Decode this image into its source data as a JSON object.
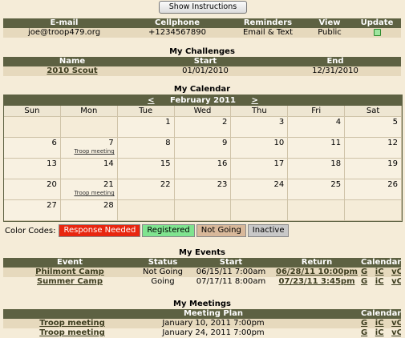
{
  "top_button": "Show Instructions",
  "contact": {
    "headers": [
      "E-mail",
      "Cellphone",
      "Reminders",
      "View",
      "Update"
    ],
    "email": "joe@troop479.org",
    "cellphone": "+1234567890",
    "reminders": "Email & Text",
    "view": "Public"
  },
  "challenges": {
    "title": "My Challenges",
    "headers": [
      "Name",
      "Start",
      "End"
    ],
    "rows": [
      [
        "2010 Scout",
        "01/01/2010",
        "12/31/2010"
      ]
    ]
  },
  "calendar": {
    "title": "My Calendar",
    "prev": "<",
    "next": ">",
    "month": "February 2011",
    "weekdays": [
      "Sun",
      "Mon",
      "Tue",
      "Wed",
      "Thu",
      "Fri",
      "Sat"
    ],
    "event_label": "Troop meeting"
  },
  "color_codes": {
    "label": "Color Codes:",
    "items": [
      {
        "text": "Response Needed",
        "color": "#e8260f",
        "fg": "#ffffff"
      },
      {
        "text": "Registered",
        "color": "#7fe38f",
        "fg": "#000000"
      },
      {
        "text": "Not Going",
        "color": "#d8b89a",
        "fg": "#000000"
      },
      {
        "text": "Inactive",
        "color": "#c8c8c8",
        "fg": "#000000"
      }
    ]
  },
  "events": {
    "title": "My Events",
    "headers": [
      "Event",
      "Status",
      "Start",
      "Return",
      "Calendar"
    ],
    "rows": [
      {
        "event": "Philmont Camp",
        "status": "Not Going",
        "start": "06/15/11 7:00am",
        "return": "06/28/11 10:00pm"
      },
      {
        "event": "Summer Camp",
        "status": "Going",
        "start": "07/17/11 8:00am",
        "return": "07/23/11 3:45pm"
      }
    ],
    "cal_links": [
      "G",
      "iC",
      "vC"
    ]
  },
  "meetings": {
    "title": "My Meetings",
    "headers": [
      "Meeting Plan",
      "Calendar"
    ],
    "rows": [
      {
        "name": "Troop meeting",
        "date": "January 10, 2011 7:00pm"
      },
      {
        "name": "Troop meeting",
        "date": "January 24, 2011 7:00pm"
      }
    ],
    "cal_links": [
      "G",
      "iC",
      "vC"
    ]
  }
}
